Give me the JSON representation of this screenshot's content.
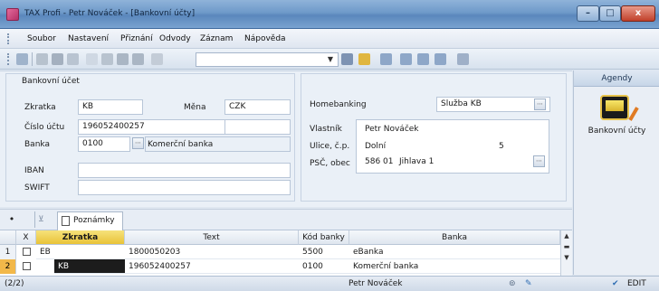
{
  "window": {
    "title": "TAX Profi - Petr Nováček   - [Bankovní účty]",
    "buttons": {
      "minimize": "–",
      "maximize": "□",
      "close": "x"
    }
  },
  "menu": {
    "items": [
      "Soubor",
      "Nastavení",
      "Přiznání",
      "Odvody",
      "Záznam",
      "Nápověda"
    ]
  },
  "toolbar": {
    "combo_value": "",
    "icons": [
      "open-icon",
      "print-icon",
      "print-preview-icon",
      "find-icon",
      "new-record-icon",
      "confirm-icon",
      "save-icon",
      "delete-icon",
      "copy-icon",
      "filter-icon",
      "folder-icon",
      "window-icon",
      "grid-icon",
      "list-icon",
      "table-icon",
      "help-icon"
    ]
  },
  "form": {
    "group_title": "Bankovní účet",
    "zkratka": {
      "label": "Zkratka",
      "value": "KB"
    },
    "mena": {
      "label": "Měna",
      "value": "CZK"
    },
    "cislo_uctu": {
      "label": "Číslo účtu",
      "value": "196052400257"
    },
    "banka": {
      "label": "Banka",
      "code": "0100",
      "name": "Komerční banka"
    },
    "iban": {
      "label": "IBAN",
      "value": ""
    },
    "swift": {
      "label": "SWIFT",
      "value": ""
    },
    "homebanking": {
      "label": "Homebanking",
      "value": "Služba KB"
    },
    "vlastnik": {
      "label": "Vlastník",
      "value": "Petr Nováček"
    },
    "ulice": {
      "label": "Ulice, č.p.",
      "value": "Dolní",
      "cp": "5"
    },
    "psc_obec": {
      "label": "PSČ, obec",
      "psc": "586 01",
      "obec": "Jihlava 1"
    }
  },
  "agendy": {
    "header": "Agendy",
    "item_label": "Bankovní účty"
  },
  "grid_tabs": {
    "add_symbol": "•",
    "notes_tab": "Poznámky"
  },
  "grid": {
    "columns": [
      "X",
      "Zkratka",
      "Text",
      "Kód banky",
      "Banka"
    ],
    "rows": [
      {
        "num": "1",
        "zkratka": "EB",
        "text": "1800050203",
        "kod": "5500",
        "banka": "eBanka"
      },
      {
        "num": "2",
        "zkratka": "KB",
        "text": "196052400257",
        "kod": "0100",
        "banka": "Komerční banka"
      }
    ]
  },
  "status": {
    "record": "(2/2)",
    "user": "Petr Nováček",
    "mode": "EDIT"
  },
  "colors": {
    "accent_sorted_column": "#e9c338",
    "active_row": "#f2b84a",
    "title_bar": "#6e99c9"
  }
}
